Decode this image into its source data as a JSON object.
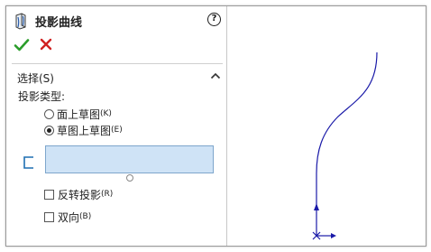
{
  "panel": {
    "title": "投影曲线",
    "help_glyph": "?",
    "feature_icon": "projected-curve-feature-icon",
    "ok_icon": "green-checkmark-icon",
    "cancel_icon": "red-x-icon",
    "ok_color": "#2a9d2a",
    "cancel_color": "#d02020",
    "section": {
      "title": "选择(S)",
      "collapsed": false,
      "projection_type_label": "投影类型:",
      "options": [
        {
          "label": "面上草图",
          "hint": "(K)",
          "selected": false
        },
        {
          "label": "草图上草图",
          "hint": "(E)",
          "selected": true
        }
      ],
      "selection_box_value": "",
      "selection_icon": "sketch-selection-icon",
      "checkboxes": [
        {
          "label": "反转投影",
          "hint": "(R)",
          "checked": false
        },
        {
          "label": "双向",
          "hint": "(B)",
          "checked": false
        }
      ]
    }
  },
  "graphics": {
    "curve_color": "#1a1aa8",
    "origin_icon": "sketch-origin-icon",
    "direction_arrow_icon": "up-arrow-icon"
  }
}
